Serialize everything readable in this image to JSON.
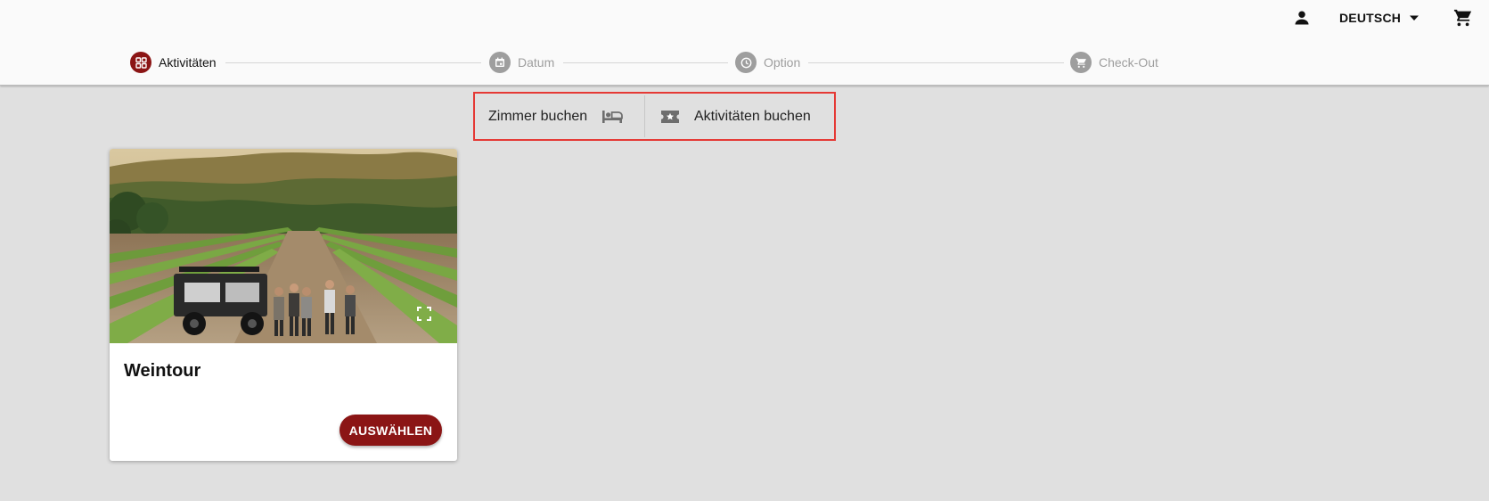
{
  "header": {
    "language": "DEUTSCH",
    "icons": {
      "user": "person-icon",
      "language_caret": "arrow-drop-down-icon",
      "cart": "shopping-cart-icon"
    }
  },
  "stepper": {
    "steps": [
      {
        "label": "Aktivitäten",
        "icon": "grid-icon",
        "state": "active"
      },
      {
        "label": "Datum",
        "icon": "calendar-icon",
        "state": "inactive"
      },
      {
        "label": "Option",
        "icon": "clock-icon",
        "state": "inactive"
      },
      {
        "label": "Check-Out",
        "icon": "cart-icon",
        "state": "inactive"
      }
    ]
  },
  "booking_switch": {
    "rooms_label": "Zimmer buchen",
    "rooms_icon": "bed-icon",
    "activities_label": "Aktivitäten buchen",
    "activities_icon": "ticket-star-icon"
  },
  "activities": [
    {
      "title": "Weintour",
      "button_label": "AUSWÄHLEN",
      "image": "vineyard-tour-photo",
      "fullscreen_icon": "fullscreen-icon"
    }
  ],
  "colors": {
    "accent": "#8b1515",
    "background": "#e0e0e0",
    "header_bg": "#fafafa",
    "inactive": "#9e9e9e",
    "highlight_border": "#e53935"
  }
}
